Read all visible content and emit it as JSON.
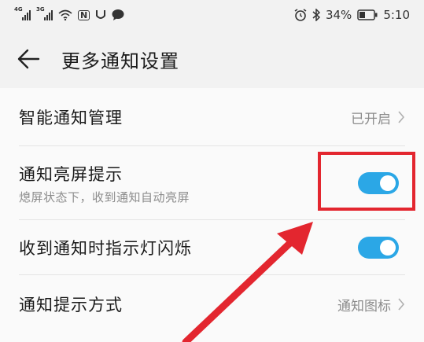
{
  "status_bar": {
    "net1": "4G",
    "net2": "3G",
    "nfc": "N",
    "battery_percent": "34%",
    "time": "5:10"
  },
  "header": {
    "title": "更多通知设置"
  },
  "rows": [
    {
      "title": "智能通知管理",
      "value": "已开启"
    },
    {
      "title": "通知亮屏提示",
      "subtitle": "熄屏状态下，收到通知自动亮屏",
      "toggle_on": true
    },
    {
      "title": "收到通知时指示灯闪烁",
      "toggle_on": true
    },
    {
      "title": "通知提示方式",
      "value": "通知图标"
    }
  ],
  "colors": {
    "toggle_on": "#2ba7e6",
    "annotation": "#e3262f"
  },
  "icons": [
    "wifi-icon",
    "nfc-icon",
    "message-icon",
    "alarm-icon",
    "bluetooth-icon",
    "battery-icon",
    "back-arrow-icon",
    "chevron-right-icon"
  ]
}
